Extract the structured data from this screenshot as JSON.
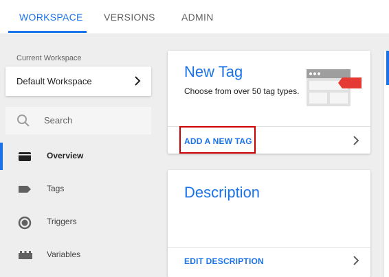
{
  "tabs": [
    {
      "label": "WORKSPACE",
      "active": true
    },
    {
      "label": "VERSIONS",
      "active": false
    },
    {
      "label": "ADMIN",
      "active": false
    }
  ],
  "sidebar": {
    "workspace_label": "Current Workspace",
    "workspace_name": "Default Workspace",
    "search_placeholder": "Search",
    "items": [
      {
        "label": "Overview",
        "icon": "overview-folder-icon",
        "selected": true
      },
      {
        "label": "Tags",
        "icon": "tag-icon",
        "selected": false
      },
      {
        "label": "Triggers",
        "icon": "trigger-icon",
        "selected": false
      },
      {
        "label": "Variables",
        "icon": "variables-icon",
        "selected": false
      }
    ]
  },
  "new_tag_card": {
    "title": "New Tag",
    "description": "Choose from over 50 tag types.",
    "action": "ADD A NEW TAG",
    "illustration": "tag-window-illustration"
  },
  "description_card": {
    "title": "Description",
    "action": "EDIT DESCRIPTION"
  },
  "colors": {
    "accent": "#1a73e8",
    "highlight": "#cc0000",
    "tag_red": "#e53935"
  }
}
